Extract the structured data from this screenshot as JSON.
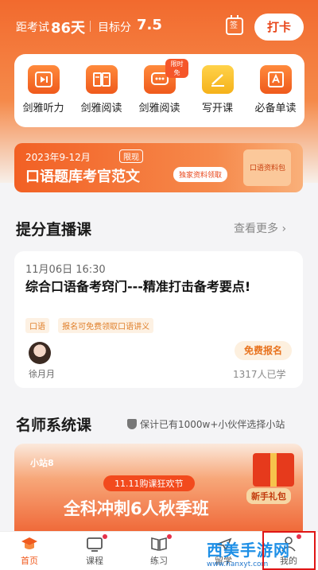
{
  "header": {
    "exam_label": "距考试",
    "exam_days": "86天",
    "target_label": "目标分",
    "target_score": "7.5",
    "calendar_icon": "calendar-icon",
    "calendar_char": "签",
    "checkin_label": "打卡"
  },
  "quick_nav": [
    {
      "label": "剑雅听力",
      "icon": "play-icon"
    },
    {
      "label": "剑雅阅读",
      "icon": "book-icon"
    },
    {
      "label": "剑雅阅读",
      "icon": "chat-icon",
      "badge": "限时免"
    },
    {
      "label": "写开课",
      "icon": "pencil-icon"
    },
    {
      "label": "必备单读",
      "icon": "vocab-icon"
    }
  ],
  "banner": {
    "date": "2023年9-12月",
    "tag": "限现",
    "title": "口语题库考官范文",
    "button": "独家资料领取",
    "gift_label": "口语资料包"
  },
  "live_section": {
    "title": "提分直播课",
    "see_more": "查看更多",
    "course": {
      "time": "11月06日 16:30",
      "title": "综合口语备考窍门---精准打击备考要点!",
      "tags": [
        "口语",
        "报名可免费领取口语讲义"
      ],
      "teacher": "徐月月",
      "signup": "免费报名",
      "learners": "1317人已学"
    }
  },
  "system_section": {
    "title": "名师系统课",
    "guarantee": "保计已有1000w+小伙伴选择小站",
    "promo": {
      "brand": "小站8",
      "subtitle": "11.11购课狂欢节",
      "title": "全科冲刺6人秋季班",
      "newbie": "新手礼包"
    }
  },
  "bottom_nav": [
    {
      "label": "首页",
      "icon": "graduation-cap-icon",
      "active": true
    },
    {
      "label": "课程",
      "icon": "tv-icon"
    },
    {
      "label": "练习",
      "icon": "book-open-icon"
    },
    {
      "label": "留学",
      "icon": "plane-icon"
    },
    {
      "label": "我的",
      "icon": "user-icon"
    }
  ],
  "watermark": {
    "main": "西美手游网",
    "sub": "www.hanxyt.com"
  },
  "colors": {
    "accent": "#f05a1e",
    "header_top": "#f26a2e",
    "tag_text": "#e0802c"
  }
}
